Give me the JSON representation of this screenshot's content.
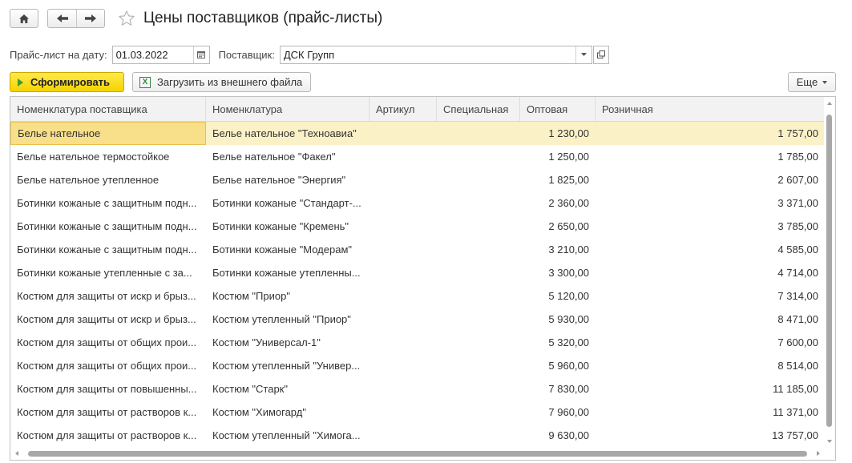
{
  "window": {
    "title": "Цены поставщиков (прайс-листы)"
  },
  "icons": {
    "home": "home-icon",
    "back": "arrow-left-icon",
    "forward": "arrow-right-icon",
    "favorite": "star-icon",
    "calendar": "calendar-icon",
    "dropdown": "chevron-down-icon",
    "open": "open-form-icon",
    "excel": "excel-icon"
  },
  "filters": {
    "date_label": "Прайс-лист на дату:",
    "date_value": "01.03.2022",
    "supplier_label": "Поставщик:",
    "supplier_value": "ДСК Групп"
  },
  "toolbar": {
    "generate_label": "Сформировать",
    "load_label": "Загрузить из внешнего файла",
    "more_label": "Еще"
  },
  "colors": {
    "accent_button": "#f5d300",
    "selected_row": "#fbf1c7",
    "selected_cell": "#f8df8a"
  },
  "table": {
    "columns": [
      "Номенклатура поставщика",
      "Номенклатура",
      "Артикул",
      "Специальная",
      "Оптовая",
      "Розничная"
    ],
    "rows": [
      {
        "supplier_item": "Белье нательное",
        "item": "Белье нательное \"Техноавиа\"",
        "article": "",
        "special": "",
        "wholesale": "1 230,00",
        "retail": "1 757,00"
      },
      {
        "supplier_item": "Белье нательное термостойкое",
        "item": "Белье нательное \"Факел\"",
        "article": "",
        "special": "",
        "wholesale": "1 250,00",
        "retail": "1 785,00"
      },
      {
        "supplier_item": "Белье нательное утепленное",
        "item": "Белье нательное \"Энергия\"",
        "article": "",
        "special": "",
        "wholesale": "1 825,00",
        "retail": "2 607,00"
      },
      {
        "supplier_item": "Ботинки кожаные с защитным подн...",
        "item": "Ботинки кожаные \"Стандарт-...",
        "article": "",
        "special": "",
        "wholesale": "2 360,00",
        "retail": "3 371,00"
      },
      {
        "supplier_item": "Ботинки кожаные с защитным подн...",
        "item": "Ботинки кожаные \"Кремень\"",
        "article": "",
        "special": "",
        "wholesale": "2 650,00",
        "retail": "3 785,00"
      },
      {
        "supplier_item": "Ботинки кожаные с защитным подн...",
        "item": "Ботинки кожаные \"Модерам\"",
        "article": "",
        "special": "",
        "wholesale": "3 210,00",
        "retail": "4 585,00"
      },
      {
        "supplier_item": "Ботинки кожаные утепленные с за...",
        "item": "Ботинки кожаные утепленны...",
        "article": "",
        "special": "",
        "wholesale": "3 300,00",
        "retail": "4 714,00"
      },
      {
        "supplier_item": "Костюм для защиты от искр и брыз...",
        "item": "Костюм \"Приор\"",
        "article": "",
        "special": "",
        "wholesale": "5 120,00",
        "retail": "7 314,00"
      },
      {
        "supplier_item": "Костюм для защиты от искр и брыз...",
        "item": "Костюм утепленный \"Приор\"",
        "article": "",
        "special": "",
        "wholesale": "5 930,00",
        "retail": "8 471,00"
      },
      {
        "supplier_item": "Костюм для защиты от общих прои...",
        "item": "Костюм \"Универсал-1\"",
        "article": "",
        "special": "",
        "wholesale": "5 320,00",
        "retail": "7 600,00"
      },
      {
        "supplier_item": "Костюм для защиты от общих прои...",
        "item": "Костюм утепленный \"Универ...",
        "article": "",
        "special": "",
        "wholesale": "5 960,00",
        "retail": "8 514,00"
      },
      {
        "supplier_item": "Костюм для защиты от повышенны...",
        "item": "Костюм \"Старк\"",
        "article": "",
        "special": "",
        "wholesale": "7 830,00",
        "retail": "11 185,00"
      },
      {
        "supplier_item": "Костюм для защиты от растворов к...",
        "item": "Костюм \"Химогард\"",
        "article": "",
        "special": "",
        "wholesale": "7 960,00",
        "retail": "11 371,00"
      },
      {
        "supplier_item": "Костюм для защиты от растворов к...",
        "item": "Костюм утепленный \"Химога...",
        "article": "",
        "special": "",
        "wholesale": "9 630,00",
        "retail": "13 757,00"
      }
    ]
  }
}
